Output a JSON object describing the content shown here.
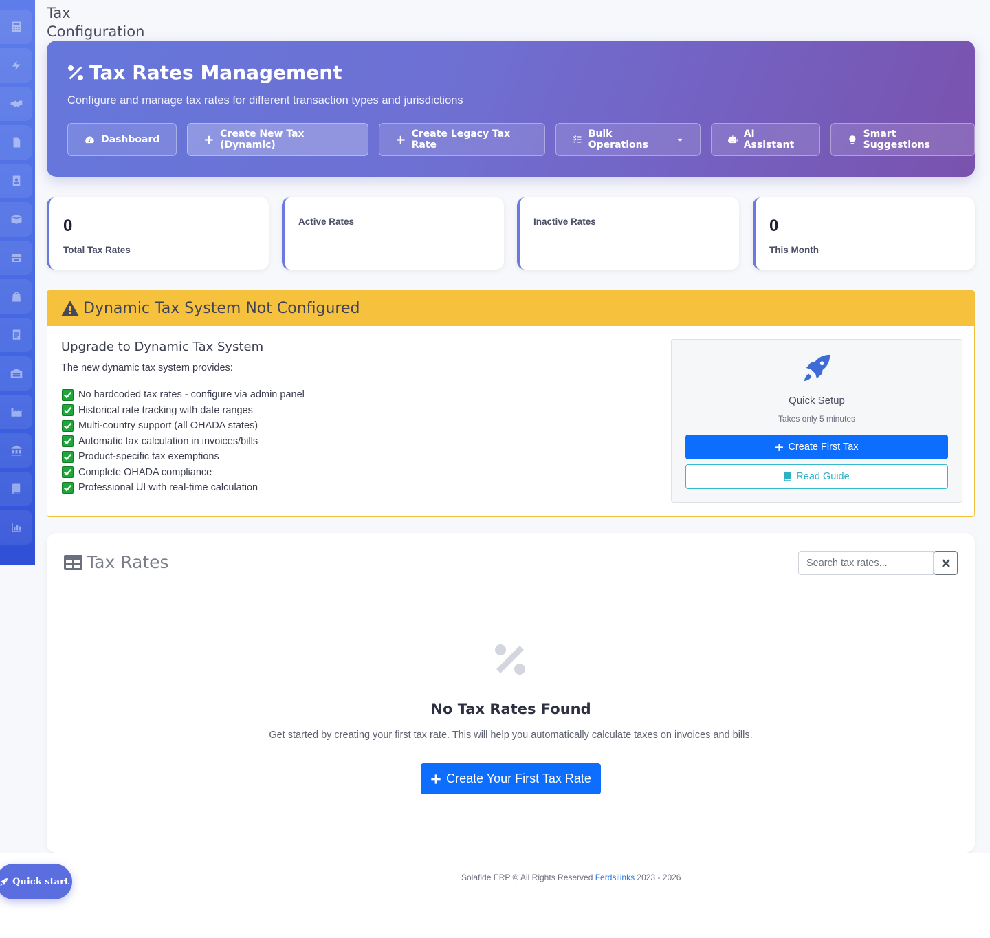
{
  "page_title": "Tax Configuration",
  "sidebar": {
    "icons": [
      "calculator-icon",
      "bolt-icon",
      "handshake-icon",
      "file-icon",
      "address-book-icon",
      "boxes-icon",
      "store-icon",
      "shopping-bag-icon",
      "receipt-icon",
      "warehouse-icon",
      "industry-icon",
      "bank-icon",
      "book-icon",
      "chart-icon"
    ]
  },
  "hero": {
    "title": "Tax Rates Management",
    "subtitle": "Configure and manage tax rates for different transaction types and jurisdictions",
    "buttons": {
      "dashboard": "Dashboard",
      "create_dynamic": "Create New Tax (Dynamic)",
      "create_legacy": "Create Legacy Tax Rate",
      "bulk": "Bulk Operations",
      "ai": "AI Assistant",
      "smart": "Smart Suggestions"
    }
  },
  "stats": [
    {
      "value": "0",
      "label": "Total Tax Rates"
    },
    {
      "value": "",
      "label": "Active Rates"
    },
    {
      "value": "",
      "label": "Inactive Rates"
    },
    {
      "value": "0",
      "label": "This Month"
    }
  ],
  "warning": {
    "title": "Dynamic Tax System Not Configured",
    "upgrade_title": "Upgrade to Dynamic Tax System",
    "intro": "The new dynamic tax system provides:",
    "features": [
      "No hardcoded tax rates - configure via admin panel",
      "Historical rate tracking with date ranges",
      "Multi-country support (all OHADA states)",
      "Automatic tax calculation in invoices/bills",
      "Product-specific tax exemptions",
      "Complete OHADA compliance",
      "Professional UI with real-time calculation"
    ],
    "setup": {
      "title": "Quick Setup",
      "subtitle": "Takes only 5 minutes",
      "create_button": "Create First Tax",
      "guide_button": "Read Guide"
    }
  },
  "rates": {
    "title": "Tax Rates",
    "search_placeholder": "Search tax rates...",
    "empty_title": "No Tax Rates Found",
    "empty_desc": "Get started by creating your first tax rate. This will help you automatically calculate taxes on invoices and bills.",
    "create_button": "Create Your First Tax Rate"
  },
  "quick_start": "Quick start",
  "footer": {
    "prefix": "Solafide ERP © All Rights Reserved ",
    "link": "Ferdsilinks",
    "suffix": " 2023 - 2026"
  },
  "colors": {
    "primary": "#0d6efd",
    "warning": "#f6c23e",
    "info": "#36b9cc",
    "hero_start": "#6577db",
    "hero_end": "#7a52ae"
  }
}
